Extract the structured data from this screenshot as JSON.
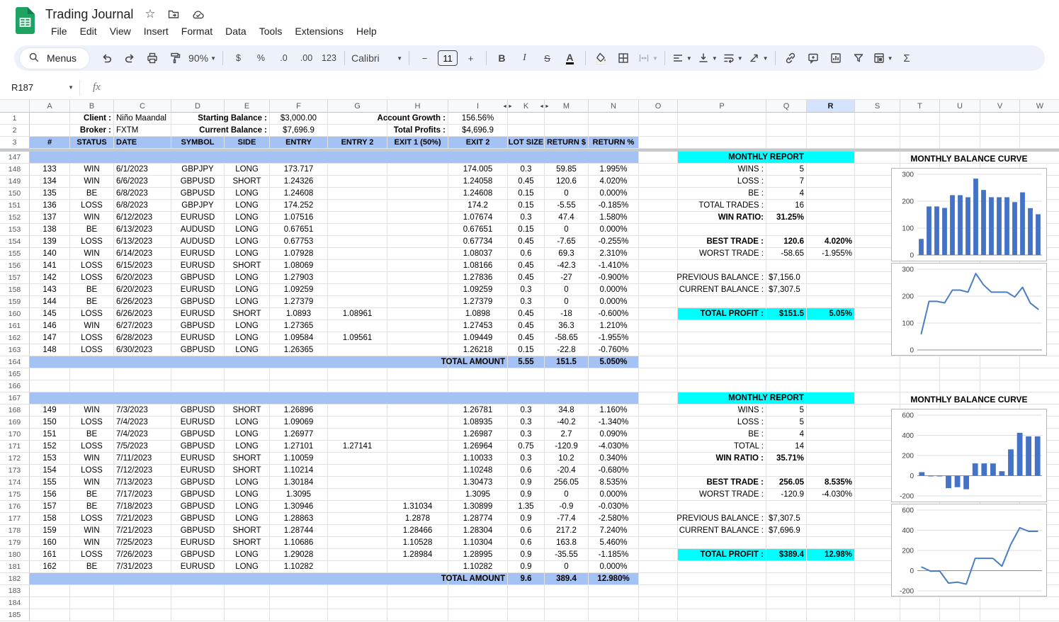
{
  "app": {
    "title": "Trading Journal",
    "menus": [
      "File",
      "Edit",
      "View",
      "Insert",
      "Format",
      "Data",
      "Tools",
      "Extensions",
      "Help"
    ]
  },
  "toolbar": {
    "search_label": "Menus",
    "zoom_level": "90%",
    "currency": "$",
    "percent": "%",
    "decimal_decrease": ".0",
    "decimal_increase": ".00",
    "format_123": "123",
    "font_name": "Calibri",
    "font_size": "11",
    "minus": "−",
    "plus": "+",
    "bold": "B",
    "italic": "I",
    "strikethrough": "S",
    "text_color": "A",
    "sigma": "Σ"
  },
  "formula_bar": {
    "name_box": "R187",
    "fx": "fx"
  },
  "grid": {
    "columns": [
      "A",
      "B",
      "C",
      "D",
      "E",
      "F",
      "G",
      "H",
      "I",
      "K",
      "M",
      "N",
      "O",
      "P",
      "Q",
      "R",
      "S",
      "T",
      "U",
      "V",
      "W"
    ],
    "selected_column": "R",
    "hidden_column_markers": [
      "I|K",
      "K|M"
    ],
    "frozen_rows": [
      1,
      2,
      3
    ],
    "body_rows_start": 147,
    "body_rows_end": 185
  },
  "info": {
    "client_label": "Client :",
    "client": "Niño Maandal",
    "broker_label": "Broker :",
    "broker": "FXTM",
    "starting_balance_label": "Starting Balance :",
    "starting_balance": "$3,000.00",
    "current_balance_label": "Current Balance :",
    "current_balance": "$7,696.9",
    "account_growth_label": "Account Growth :",
    "account_growth": "156.56%",
    "total_profits_label": "Total Profits :",
    "total_profits": "$4,696.9"
  },
  "table": {
    "headers": [
      "#",
      "STATUS",
      "DATE",
      "SYMBOL",
      "SIDE",
      "ENTRY",
      "ENTRY 2",
      "EXIT 1 (50%)",
      "EXIT 2",
      "LOT SIZE",
      "RETURN $",
      "RETURN %"
    ],
    "total_label": "TOTAL AMOUNT",
    "june": {
      "band_row": 147,
      "first_data_row": 148,
      "trades": [
        [
          "133",
          "WIN",
          "6/1/2023",
          "GBPJPY",
          "LONG",
          "173.717",
          "",
          "",
          "174.005",
          "0.3",
          "59.85",
          "1.995%"
        ],
        [
          "134",
          "WIN",
          "6/6/2023",
          "GBPUSD",
          "SHORT",
          "1.24326",
          "",
          "",
          "1.24058",
          "0.45",
          "120.6",
          "4.020%"
        ],
        [
          "135",
          "BE",
          "6/8/2023",
          "GBPUSD",
          "LONG",
          "1.24608",
          "",
          "",
          "1.24608",
          "0.15",
          "0",
          "0.000%"
        ],
        [
          "136",
          "LOSS",
          "6/8/2023",
          "GBPJPY",
          "LONG",
          "174.252",
          "",
          "",
          "174.2",
          "0.15",
          "-5.55",
          "-0.185%"
        ],
        [
          "137",
          "WIN",
          "6/12/2023",
          "EURUSD",
          "LONG",
          "1.07516",
          "",
          "",
          "1.07674",
          "0.3",
          "47.4",
          "1.580%"
        ],
        [
          "138",
          "BE",
          "6/13/2023",
          "AUDUSD",
          "LONG",
          "0.67651",
          "",
          "",
          "0.67651",
          "0.15",
          "0",
          "0.000%"
        ],
        [
          "139",
          "LOSS",
          "6/13/2023",
          "AUDUSD",
          "LONG",
          "0.67753",
          "",
          "",
          "0.67734",
          "0.45",
          "-7.65",
          "-0.255%"
        ],
        [
          "140",
          "WIN",
          "6/14/2023",
          "EURUSD",
          "LONG",
          "1.07928",
          "",
          "",
          "1.08037",
          "0.6",
          "69.3",
          "2.310%"
        ],
        [
          "141",
          "LOSS",
          "6/15/2023",
          "EURUSD",
          "SHORT",
          "1.08069",
          "",
          "",
          "1.08166",
          "0.45",
          "-42.3",
          "-1.410%"
        ],
        [
          "142",
          "LOSS",
          "6/20/2023",
          "GBPUSD",
          "LONG",
          "1.27903",
          "",
          "",
          "1.27836",
          "0.45",
          "-27",
          "-0.900%"
        ],
        [
          "143",
          "BE",
          "6/20/2023",
          "EURUSD",
          "LONG",
          "1.09259",
          "",
          "",
          "1.09259",
          "0.3",
          "0",
          "0.000%"
        ],
        [
          "144",
          "BE",
          "6/26/2023",
          "GBPUSD",
          "LONG",
          "1.27379",
          "",
          "",
          "1.27379",
          "0.3",
          "0",
          "0.000%"
        ],
        [
          "145",
          "LOSS",
          "6/26/2023",
          "EURUSD",
          "SHORT",
          "1.0893",
          "1.08961",
          "",
          "1.0898",
          "0.45",
          "-18",
          "-0.600%"
        ],
        [
          "146",
          "WIN",
          "6/27/2023",
          "GBPUSD",
          "LONG",
          "1.27365",
          "",
          "",
          "1.27453",
          "0.45",
          "36.3",
          "1.210%"
        ],
        [
          "147",
          "LOSS",
          "6/28/2023",
          "EURUSD",
          "LONG",
          "1.09584",
          "1.09561",
          "",
          "1.09449",
          "0.45",
          "-58.65",
          "-1.955%"
        ],
        [
          "148",
          "LOSS",
          "6/30/2023",
          "GBPUSD",
          "LONG",
          "1.26365",
          "",
          "",
          "1.26218",
          "0.15",
          "-22.8",
          "-0.760%"
        ]
      ],
      "total_row": 164,
      "total": [
        "5.55",
        "151.5",
        "5.050%"
      ]
    },
    "july": {
      "band_row": 167,
      "first_data_row": 168,
      "trades": [
        [
          "149",
          "WIN",
          "7/3/2023",
          "GBPUSD",
          "SHORT",
          "1.26896",
          "",
          "",
          "1.26781",
          "0.3",
          "34.8",
          "1.160%"
        ],
        [
          "150",
          "LOSS",
          "7/4/2023",
          "EURUSD",
          "LONG",
          "1.09069",
          "",
          "",
          "1.08935",
          "0.3",
          "-40.2",
          "-1.340%"
        ],
        [
          "151",
          "BE",
          "7/4/2023",
          "GBPUSD",
          "LONG",
          "1.26977",
          "",
          "",
          "1.26987",
          "0.3",
          "2.7",
          "0.090%"
        ],
        [
          "152",
          "LOSS",
          "7/5/2023",
          "GBPUSD",
          "LONG",
          "1.27101",
          "1.27141",
          "",
          "1.26964",
          "0.75",
          "-120.9",
          "-4.030%"
        ],
        [
          "153",
          "WIN",
          "7/11/2023",
          "EURUSD",
          "SHORT",
          "1.10059",
          "",
          "",
          "1.10033",
          "0.3",
          "10.2",
          "0.340%"
        ],
        [
          "154",
          "LOSS",
          "7/12/2023",
          "EURUSD",
          "SHORT",
          "1.10214",
          "",
          "",
          "1.10248",
          "0.6",
          "-20.4",
          "-0.680%"
        ],
        [
          "155",
          "WIN",
          "7/13/2023",
          "GBPUSD",
          "LONG",
          "1.30184",
          "",
          "",
          "1.30473",
          "0.9",
          "256.05",
          "8.535%"
        ],
        [
          "156",
          "BE",
          "7/17/2023",
          "GBPUSD",
          "LONG",
          "1.3095",
          "",
          "",
          "1.3095",
          "0.9",
          "0",
          "0.000%"
        ],
        [
          "157",
          "BE",
          "7/18/2023",
          "GBPUSD",
          "LONG",
          "1.30946",
          "",
          "1.31034",
          "1.30899",
          "1.35",
          "-0.9",
          "-0.030%"
        ],
        [
          "158",
          "LOSS",
          "7/21/2023",
          "GBPUSD",
          "LONG",
          "1.28863",
          "",
          "1.2878",
          "1.28774",
          "0.9",
          "-77.4",
          "-2.580%"
        ],
        [
          "159",
          "WIN",
          "7/21/2023",
          "GBPUSD",
          "SHORT",
          "1.28744",
          "",
          "1.28466",
          "1.28304",
          "0.6",
          "217.2",
          "7.240%"
        ],
        [
          "160",
          "WIN",
          "7/25/2023",
          "EURUSD",
          "SHORT",
          "1.10686",
          "",
          "1.10528",
          "1.10304",
          "0.6",
          "163.8",
          "5.460%"
        ],
        [
          "161",
          "LOSS",
          "7/26/2023",
          "GBPUSD",
          "LONG",
          "1.29028",
          "",
          "1.28984",
          "1.28995",
          "0.9",
          "-35.55",
          "-1.185%"
        ],
        [
          "162",
          "BE",
          "7/31/2023",
          "EURUSD",
          "LONG",
          "1.10282",
          "",
          "",
          "1.10282",
          "0.9",
          "0",
          "0.000%"
        ]
      ],
      "total_row": 182,
      "total": [
        "9.6",
        "389.4",
        "12.980%"
      ]
    }
  },
  "reports": [
    {
      "anchor_row": 147,
      "title": "MONTHLY REPORT",
      "rows": [
        {
          "offset": 1,
          "label": "WINS :",
          "value": "5"
        },
        {
          "offset": 2,
          "label": "LOSS :",
          "value": "7"
        },
        {
          "offset": 3,
          "label": "BE :",
          "value": "4"
        },
        {
          "offset": 4,
          "label": "TOTAL TRADES :",
          "value": "16"
        },
        {
          "offset": 5,
          "label": "WIN RATIO:",
          "value": "31.25%",
          "bold": true
        },
        {
          "offset": 7,
          "label": "BEST TRADE :",
          "value": "120.6",
          "pct": "4.020%",
          "bold": true
        },
        {
          "offset": 8,
          "label": "WORST TRADE :",
          "value": "-58.65",
          "pct": "-1.955%"
        },
        {
          "offset": 10,
          "label": "PREVIOUS BALANCE :",
          "value": "$7,156.0",
          "value_align": "left"
        },
        {
          "offset": 11,
          "label": "CURRENT BALANCE :",
          "value": "$7,307.5",
          "value_align": "left"
        },
        {
          "offset": 13,
          "label": "TOTAL PROFIT :",
          "value": "$151.5",
          "pct": "5.05%",
          "bold": true,
          "cyan": true
        }
      ]
    },
    {
      "anchor_row": 167,
      "title": "MONTHLY REPORT",
      "rows": [
        {
          "offset": 1,
          "label": "WINS :",
          "value": "5"
        },
        {
          "offset": 2,
          "label": "LOSS :",
          "value": "5"
        },
        {
          "offset": 3,
          "label": "BE :",
          "value": "4"
        },
        {
          "offset": 4,
          "label": "TOTAL :",
          "value": "14"
        },
        {
          "offset": 5,
          "label": "WIN RATIO :",
          "value": "35.71%",
          "bold": true
        },
        {
          "offset": 7,
          "label": "BEST TRADE :",
          "value": "256.05",
          "pct": "8.535%",
          "bold": true
        },
        {
          "offset": 8,
          "label": "WORST TRADE :",
          "value": "-120.9",
          "pct": "-4.030%"
        },
        {
          "offset": 10,
          "label": "PREVIOUS BALANCE :",
          "value": "$7,307.5",
          "value_align": "left"
        },
        {
          "offset": 11,
          "label": "CURRENT BALANCE :",
          "value": "$7,696.9",
          "value_align": "left"
        },
        {
          "offset": 13,
          "label": "TOTAL PROFIT :",
          "value": "$389.4",
          "pct": "12.98%",
          "bold": true,
          "cyan": true
        }
      ]
    }
  ],
  "chart_data": [
    {
      "title": "MONTHLY BALANCE CURVE",
      "anchor_row": 147,
      "panels": [
        {
          "type": "bar",
          "values": [
            59.85,
            180.45,
            180.45,
            174.9,
            222.3,
            222.3,
            214.65,
            283.95,
            241.65,
            214.65,
            214.65,
            214.65,
            196.65,
            232.95,
            174.3,
            151.5
          ],
          "ylim": [
            0,
            300
          ],
          "yticks": [
            0,
            100,
            200,
            300
          ],
          "color": "#4472c4"
        },
        {
          "type": "line",
          "values": [
            59.85,
            180.45,
            180.45,
            174.9,
            222.3,
            222.3,
            214.65,
            283.95,
            241.65,
            214.65,
            214.65,
            214.65,
            196.65,
            232.95,
            174.3,
            151.5
          ],
          "ylim": [
            0,
            300
          ],
          "yticks": [
            0,
            100,
            200,
            300
          ],
          "color": "#4a7dc4"
        }
      ]
    },
    {
      "title": "MONTHLY BALANCE CURVE",
      "anchor_row": 167,
      "panels": [
        {
          "type": "bar",
          "values": [
            34.8,
            -5.4,
            -2.7,
            -123.6,
            -113.4,
            -133.8,
            122.25,
            122.25,
            121.35,
            43.95,
            261.15,
            424.95,
            389.4,
            389.4
          ],
          "ylim": [
            -200,
            600
          ],
          "yticks": [
            -200,
            0,
            200,
            400,
            600
          ],
          "color": "#4472c4"
        },
        {
          "type": "line",
          "values": [
            34.8,
            -5.4,
            -2.7,
            -123.6,
            -113.4,
            -133.8,
            122.25,
            122.25,
            121.35,
            43.95,
            261.15,
            424.95,
            389.4,
            389.4
          ],
          "ylim": [
            -200,
            600
          ],
          "yticks": [
            -200,
            0,
            200,
            400,
            600
          ],
          "color": "#4a7dc4"
        }
      ]
    }
  ],
  "colors": {
    "band_blue": "#a4c2f4",
    "report_cyan": "#00ffff",
    "selected_header": "#d3e3fd",
    "chart_blue": "#4472c4",
    "logo_green": "#1ea362",
    "toolbar_bg": "#edf2fa"
  }
}
